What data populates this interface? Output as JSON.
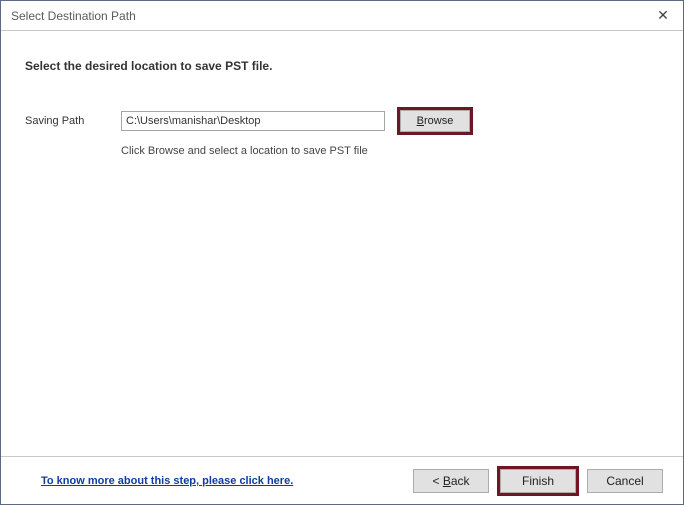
{
  "title": "Select Destination Path",
  "instruction": "Select the desired location to save PST file.",
  "path_label": "Saving Path",
  "path_value": "C:\\Users\\manishar\\Desktop",
  "browse_label": "Browse",
  "hint": "Click Browse and select a location to save PST file",
  "help_link": "To know more about this step, please click here.",
  "back_label": "< Back",
  "finish_label": "Finish",
  "cancel_label": "Cancel"
}
